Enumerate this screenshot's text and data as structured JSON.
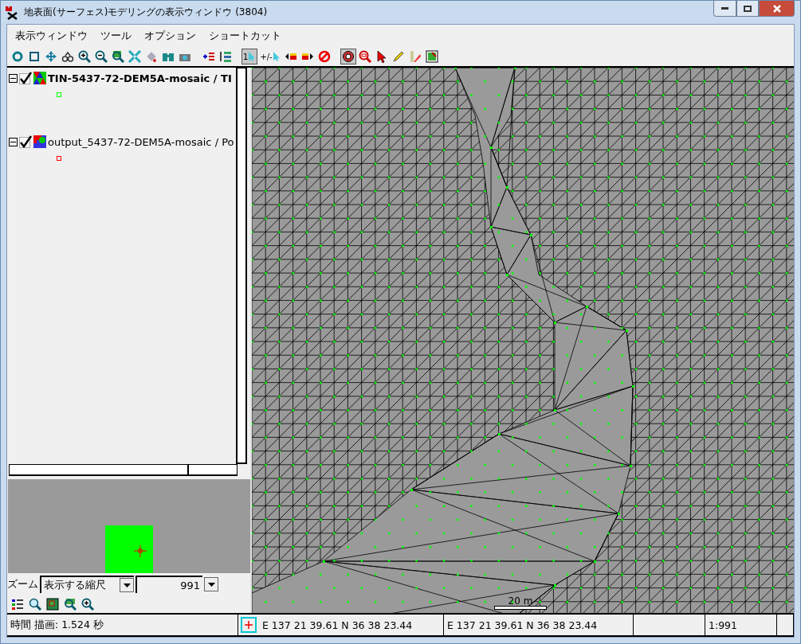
{
  "window": {
    "title": "地表面(サーフェス)モデリングの表示ウィンドウ (3804)"
  },
  "menu": [
    "表示ウィンドウ",
    "ツール",
    "オプション",
    "ショートカット"
  ],
  "toolbar": [
    {
      "kind": "icon",
      "selected": false
    },
    {
      "kind": "icon",
      "selected": false
    },
    {
      "kind": "icon",
      "selected": false
    },
    {
      "kind": "icon",
      "selected": false
    },
    {
      "kind": "icon",
      "selected": false
    },
    {
      "kind": "icon",
      "selected": false
    },
    {
      "kind": "icon",
      "selected": false
    },
    {
      "kind": "icon",
      "selected": false
    },
    {
      "kind": "icon",
      "selected": false
    },
    {
      "kind": "icon",
      "selected": false
    },
    {
      "kind": "icon",
      "selected": false
    },
    {
      "kind": "gap"
    },
    {
      "kind": "icon",
      "selected": false
    },
    {
      "kind": "icon",
      "selected": false
    },
    {
      "kind": "gap"
    },
    {
      "kind": "label",
      "label": "1",
      "selected": true
    },
    {
      "kind": "label",
      "label": "+/-",
      "selected": false
    },
    {
      "kind": "icon",
      "selected": false
    },
    {
      "kind": "icon",
      "selected": false
    },
    {
      "kind": "icon",
      "selected": false
    },
    {
      "kind": "gap"
    },
    {
      "kind": "icon",
      "selected": true
    },
    {
      "kind": "icon",
      "selected": false
    },
    {
      "kind": "icon",
      "selected": false
    },
    {
      "kind": "icon",
      "selected": false
    },
    {
      "kind": "icon",
      "selected": false
    },
    {
      "kind": "icon",
      "selected": false
    }
  ],
  "layers": [
    {
      "label": "TIN-5437-72-DEM5A-mosaic / TI",
      "selected": true,
      "checked": true,
      "expanded": true,
      "color": "#00ff00"
    },
    {
      "label": "output_5437-72-DEM5A-mosaic / Po",
      "selected": false,
      "checked": true,
      "expanded": true,
      "color": "#ff0000"
    }
  ],
  "zoom": {
    "label": "ズーム",
    "mode": "表示する縮尺",
    "value": "991"
  },
  "map": {
    "scale": "20 m"
  },
  "status_bar": [
    {
      "kind": "text",
      "text": "時間 描画: 1.524 秒"
    },
    {
      "kind": "coords",
      "text": "E 137 21 39.61  N 36 38 23.44"
    },
    {
      "kind": "text",
      "text": "E 137 21 39.61  N 36 38 23.44"
    },
    {
      "kind": "blank"
    },
    {
      "kind": "text",
      "text": "1:991"
    },
    {
      "kind": "blank"
    }
  ]
}
